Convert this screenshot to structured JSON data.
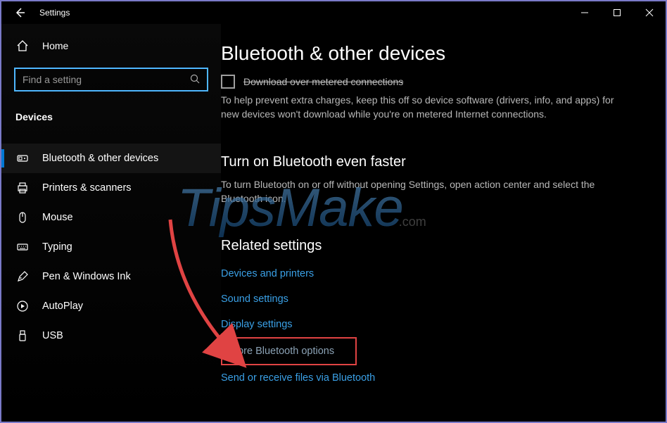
{
  "titlebar": {
    "app_name": "Settings"
  },
  "sidebar": {
    "home_label": "Home",
    "search_placeholder": "Find a setting",
    "category_label": "Devices",
    "items": [
      {
        "label": "Bluetooth & other devices",
        "icon": "bluetooth-icon",
        "active": true
      },
      {
        "label": "Printers & scanners",
        "icon": "printer-icon"
      },
      {
        "label": "Mouse",
        "icon": "mouse-icon"
      },
      {
        "label": "Typing",
        "icon": "keyboard-icon"
      },
      {
        "label": "Pen & Windows Ink",
        "icon": "pen-icon"
      },
      {
        "label": "AutoPlay",
        "icon": "autoplay-icon"
      },
      {
        "label": "USB",
        "icon": "usb-icon"
      }
    ]
  },
  "main": {
    "page_title": "Bluetooth & other devices",
    "metered_checkbox_label": "Download over metered connections",
    "metered_desc": "To help prevent extra charges, keep this off so device software (drivers, info, and apps) for new devices won't download while you're on metered Internet connections.",
    "faster_heading": "Turn on Bluetooth even faster",
    "faster_desc": "To turn Bluetooth on or off without opening Settings, open action center and select the Bluetooth icon.",
    "related_heading": "Related settings",
    "links": {
      "devices_printers": "Devices and printers",
      "sound": "Sound settings",
      "display": "Display settings",
      "more_bluetooth": "More Bluetooth options",
      "send_receive": "Send or receive files via Bluetooth"
    }
  },
  "watermark": {
    "brand": "TipsMake",
    "suffix": ".com"
  }
}
